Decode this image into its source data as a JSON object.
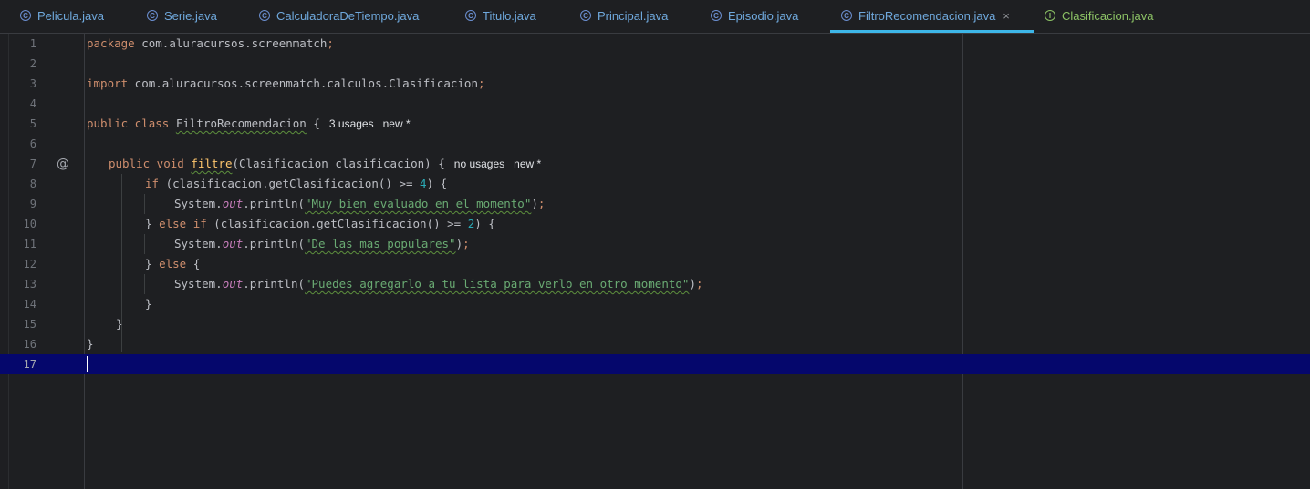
{
  "tabs": [
    {
      "label": "Pelicula.java",
      "icon": "class-icon"
    },
    {
      "label": "Serie.java",
      "icon": "class-icon"
    },
    {
      "label": "CalculadoraDeTiempo.java",
      "icon": "class-icon"
    },
    {
      "label": "Titulo.java",
      "icon": "class-icon"
    },
    {
      "label": "Principal.java",
      "icon": "run-class-icon"
    },
    {
      "label": "Episodio.java",
      "icon": "class-icon"
    },
    {
      "label": "FiltroRecomendacion.java",
      "icon": "class-icon",
      "active": true,
      "close": "×"
    },
    {
      "label": "Clasificacion.java",
      "icon": "interface-icon"
    }
  ],
  "gutter": {
    "marker_line_7": "@"
  },
  "line_numbers": [
    "1",
    "2",
    "3",
    "4",
    "5",
    "6",
    "7",
    "8",
    "9",
    "10",
    "11",
    "12",
    "13",
    "14",
    "15",
    "16",
    "17"
  ],
  "code": {
    "l1_kw": "package",
    "l1_rest": " com.aluracursos.screenmatch",
    "l1_semi": ";",
    "l3_kw": "import",
    "l3_rest": " com.aluracursos.screenmatch.calculos.Clasificacion",
    "l3_semi": ";",
    "l5_kw": "public class ",
    "l5_name": "FiltroRecomendacion",
    "l5_rest": " {",
    "l5_hint1": "3 usages",
    "l5_hint2": "new *",
    "l7_kw": "public void ",
    "l7_name": "filtre",
    "l7_rest": "(Clasificacion clasificacion) {",
    "l7_hint1": "no usages",
    "l7_hint2": "new *",
    "l8_kw": "if",
    "l8_a": " (clasificacion.getClasificacion() >= ",
    "l8_num": "4",
    "l8_b": ") {",
    "l9_a": "System.",
    "l9_out": "out",
    "l9_b": ".println(",
    "l9_str": "\"Muy bien evaluado en el momento\"",
    "l9_c": ")",
    "l9_semi": ";",
    "l10_a": "} ",
    "l10_kw": "else if",
    "l10_b": " (clasificacion.getClasificacion() >= ",
    "l10_num": "2",
    "l10_c": ") {",
    "l11_a": "System.",
    "l11_out": "out",
    "l11_b": ".println(",
    "l11_str": "\"De las mas populares\"",
    "l11_c": ")",
    "l11_semi": ";",
    "l12_a": "} ",
    "l12_kw": "else",
    "l12_b": " {",
    "l13_a": "System.",
    "l13_out": "out",
    "l13_b": ".println(",
    "l13_str": "\"Puedes agregarlo a tu lista para verlo en otro momento\"",
    "l13_c": ")",
    "l13_semi": ";",
    "l14": "}",
    "l15": "}",
    "l16": "}"
  },
  "current_line": "17",
  "colors": {
    "background": "#1e1f22",
    "current_line": "#05076c",
    "keyword": "#cf8e6d",
    "string": "#6aab73",
    "number": "#2aacb8",
    "static_field": "#c77dbb",
    "method_decl": "#ffc66d",
    "active_tab_underline": "#3db6e8"
  }
}
